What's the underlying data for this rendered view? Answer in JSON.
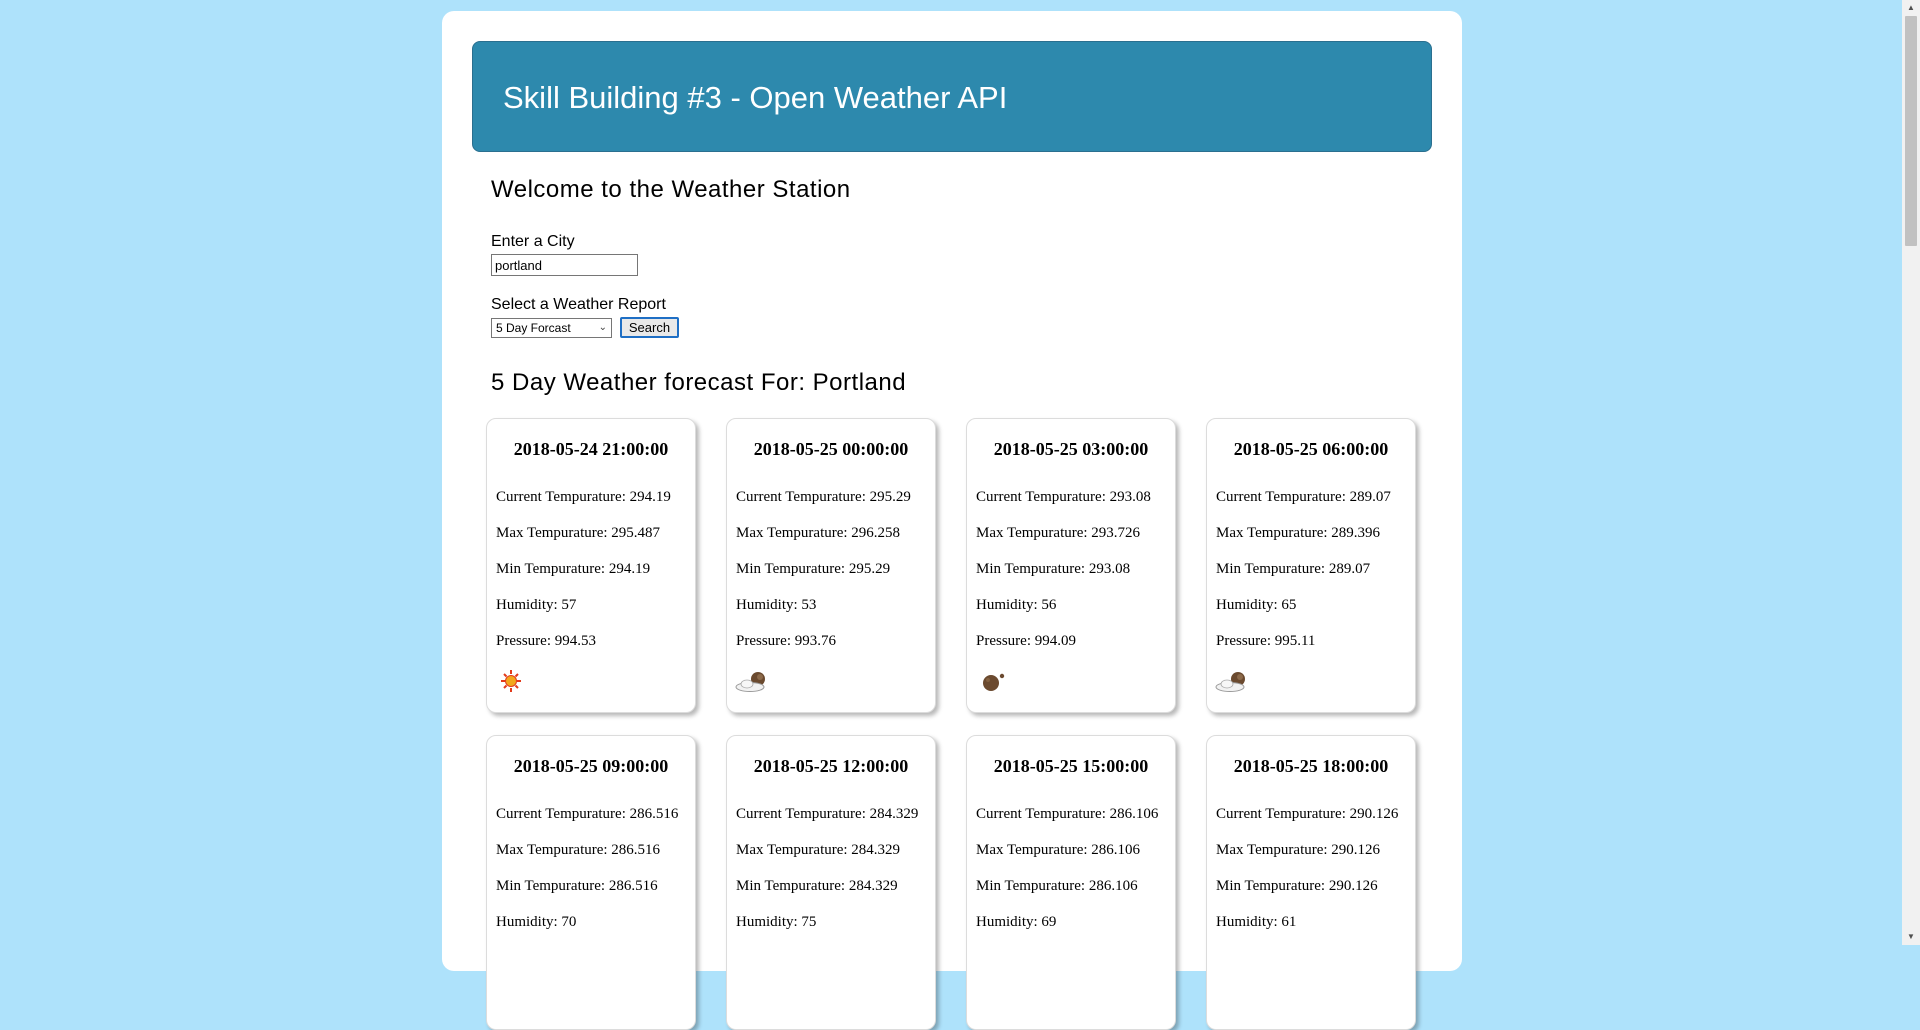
{
  "banner": {
    "title": "Skill Building #3 - Open Weather API"
  },
  "welcome": {
    "heading": "Welcome to the Weather Station"
  },
  "form": {
    "city_label": "Enter a City",
    "city_value": "portland",
    "report_label": "Select a Weather Report",
    "report_selected": "5 Day Forcast",
    "search_label": "Search"
  },
  "forecast": {
    "heading": "5 Day Weather forecast For: Portland",
    "cards": [
      {
        "date": "2018-05-24 21:00:00",
        "current": "Current Tempurature: 294.19",
        "max": "Max Tempurature: 295.487",
        "min": "Min Tempurature: 294.19",
        "humidity": "Humidity: 57",
        "pressure": "Pressure: 994.53",
        "icon": "sun-icon"
      },
      {
        "date": "2018-05-25 00:00:00",
        "current": "Current Tempurature: 295.29",
        "max": "Max Tempurature: 296.258",
        "min": "Min Tempurature: 295.29",
        "humidity": "Humidity: 53",
        "pressure": "Pressure: 993.76",
        "icon": "moon-cloud-icon"
      },
      {
        "date": "2018-05-25 03:00:00",
        "current": "Current Tempurature: 293.08",
        "max": "Max Tempurature: 293.726",
        "min": "Min Tempurature: 293.08",
        "humidity": "Humidity: 56",
        "pressure": "Pressure: 994.09",
        "icon": "moon-icon"
      },
      {
        "date": "2018-05-25 06:00:00",
        "current": "Current Tempurature: 289.07",
        "max": "Max Tempurature: 289.396",
        "min": "Min Tempurature: 289.07",
        "humidity": "Humidity: 65",
        "pressure": "Pressure: 995.11",
        "icon": "moon-cloud-icon"
      },
      {
        "date": "2018-05-25 09:00:00",
        "current": "Current Tempurature: 286.516",
        "max": "Max Tempurature: 286.516",
        "min": "Min Tempurature: 286.516",
        "humidity": "Humidity: 70"
      },
      {
        "date": "2018-05-25 12:00:00",
        "current": "Current Tempurature: 284.329",
        "max": "Max Tempurature: 284.329",
        "min": "Min Tempurature: 284.329",
        "humidity": "Humidity: 75"
      },
      {
        "date": "2018-05-25 15:00:00",
        "current": "Current Tempurature: 286.106",
        "max": "Max Tempurature: 286.106",
        "min": "Min Tempurature: 286.106",
        "humidity": "Humidity: 69"
      },
      {
        "date": "2018-05-25 18:00:00",
        "current": "Current Tempurature: 290.126",
        "max": "Max Tempurature: 290.126",
        "min": "Min Tempurature: 290.126",
        "humidity": "Humidity: 61"
      }
    ]
  },
  "colors": {
    "page_bg": "#aee2fb",
    "banner_bg": "#2d89ad",
    "card_bg": "#ffffff"
  }
}
